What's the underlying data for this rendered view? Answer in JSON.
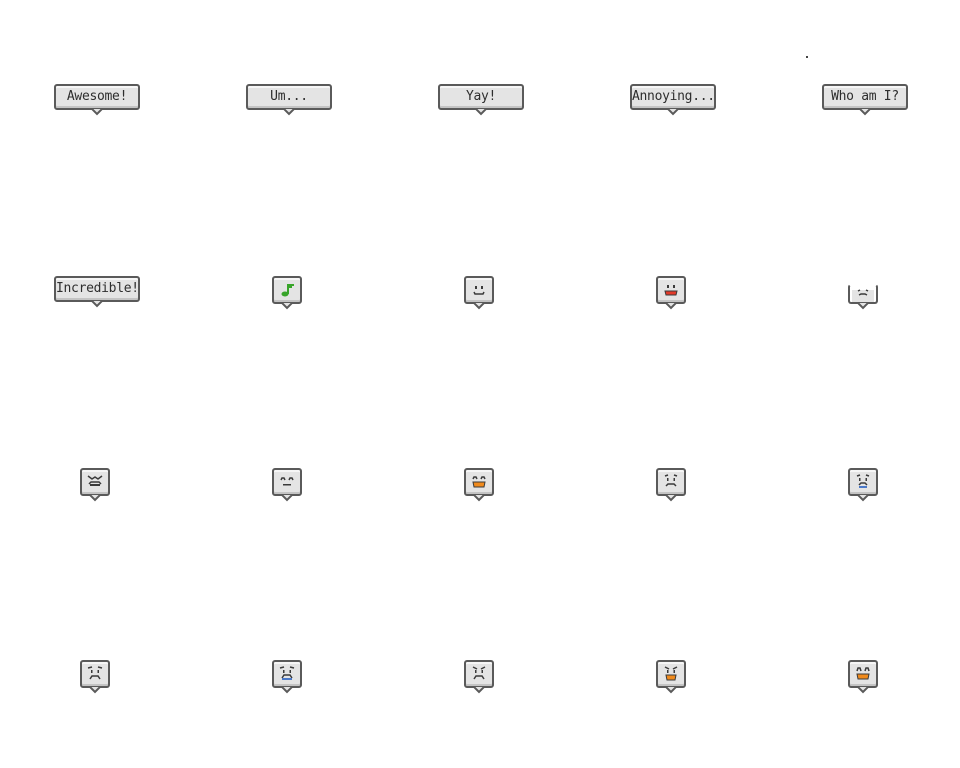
{
  "colors": {
    "outline": "#5a5a5a",
    "fill": "#e4e4e4",
    "ink": "#3a3a3a",
    "red_mouth": "#e23a2a",
    "orange_mouth": "#f08a1c",
    "blue_tear": "#4a78c8",
    "green_note": "#38a52a"
  },
  "text_bubbles": [
    {
      "label": "Awesome!"
    },
    {
      "label": "Um..."
    },
    {
      "label": "Yay!"
    },
    {
      "label": "Annoying..."
    },
    {
      "label": "Who am I?"
    },
    {
      "label": "Incredible!"
    }
  ],
  "face_bubbles": [
    {
      "icon": "music-note-icon",
      "accent": "green"
    },
    {
      "icon": "smile-face-icon",
      "accent": "none"
    },
    {
      "icon": "happy-open-mouth-face-icon",
      "accent": "red"
    },
    {
      "icon": "sad-face-partial-icon",
      "accent": "none"
    },
    {
      "icon": "crying-face-icon",
      "accent": "none"
    },
    {
      "icon": "content-face-icon",
      "accent": "none"
    },
    {
      "icon": "laughing-face-icon",
      "accent": "orange"
    },
    {
      "icon": "worried-face-icon",
      "accent": "none"
    },
    {
      "icon": "sad-tear-face-icon",
      "accent": "blue"
    },
    {
      "icon": "frown-face-icon",
      "accent": "none"
    },
    {
      "icon": "cry-blue-face-icon",
      "accent": "blue"
    },
    {
      "icon": "angry-face-icon",
      "accent": "none"
    },
    {
      "icon": "shocked-orange-face-icon",
      "accent": "orange"
    },
    {
      "icon": "surprised-orange-face-icon",
      "accent": "orange"
    }
  ]
}
